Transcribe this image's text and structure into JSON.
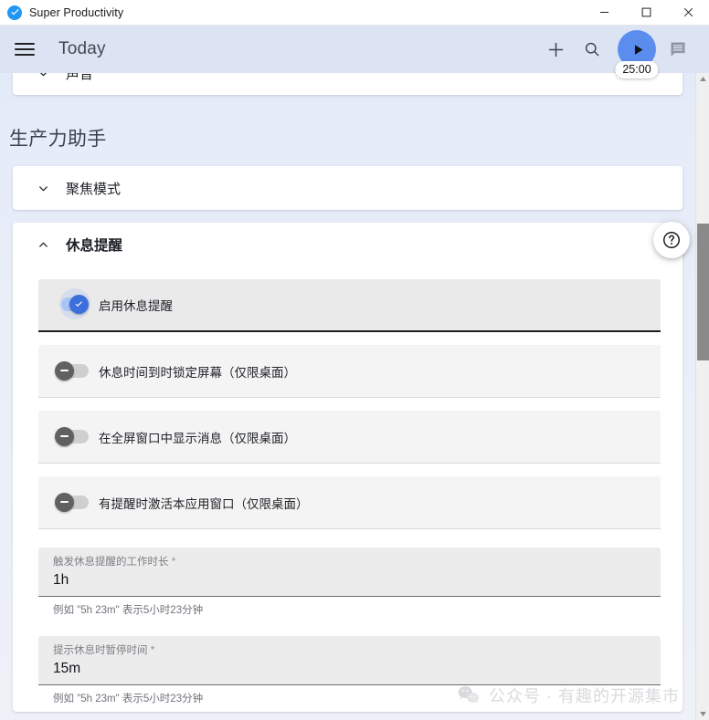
{
  "window": {
    "app_title": "Super Productivity",
    "app_icon": "check-circle-icon",
    "minimize_label": "–",
    "maximize_label": "□",
    "close_label": "✕"
  },
  "toolbar": {
    "menu_icon": "hamburger-menu-icon",
    "title": "Today",
    "add_icon": "plus-icon",
    "search_icon": "search-icon",
    "play_icon": "play-icon",
    "timer_value": "25:00",
    "notes_icon": "notes-icon"
  },
  "partial_panel": {
    "title": "声音",
    "chevron": "chevron-down-icon"
  },
  "section": {
    "heading": "生产力助手"
  },
  "focus_panel": {
    "title": "聚焦模式",
    "chevron": "chevron-down-icon"
  },
  "break_panel": {
    "title": "休息提醒",
    "chevron": "chevron-up-icon",
    "toggles": [
      {
        "label": "启用休息提醒",
        "state": "on",
        "icon": "check-icon"
      },
      {
        "label": "休息时间到时锁定屏幕（仅限桌面）",
        "state": "off",
        "icon": "minus-icon"
      },
      {
        "label": "在全屏窗口中显示消息（仅限桌面）",
        "state": "off",
        "icon": "minus-icon"
      },
      {
        "label": "有提醒时激活本应用窗口（仅限桌面）",
        "state": "off",
        "icon": "minus-icon"
      }
    ],
    "fields": [
      {
        "label": "触发休息提醒的工作时长",
        "required_marker": "*",
        "value": "1h",
        "hint": "例如 \"5h 23m\" 表示5小时23分钟"
      },
      {
        "label": "提示休息时暂停时间",
        "required_marker": "*",
        "value": "15m",
        "hint": "例如 \"5h 23m\" 表示5小时23分钟"
      }
    ]
  },
  "help_fab": {
    "icon": "help-circle-icon"
  },
  "scrollbar": {
    "up_icon": "triangle-up-icon",
    "down_icon": "triangle-down-icon"
  },
  "watermark": {
    "icon": "wechat-icon",
    "text": "公众号 · 有趣的开源集市"
  },
  "colors": {
    "toolbar_bg": "#dce4f4",
    "accent_blue": "#3b6fdb",
    "timer_blue": "#5b8def",
    "page_bg": "#e8eef8"
  }
}
